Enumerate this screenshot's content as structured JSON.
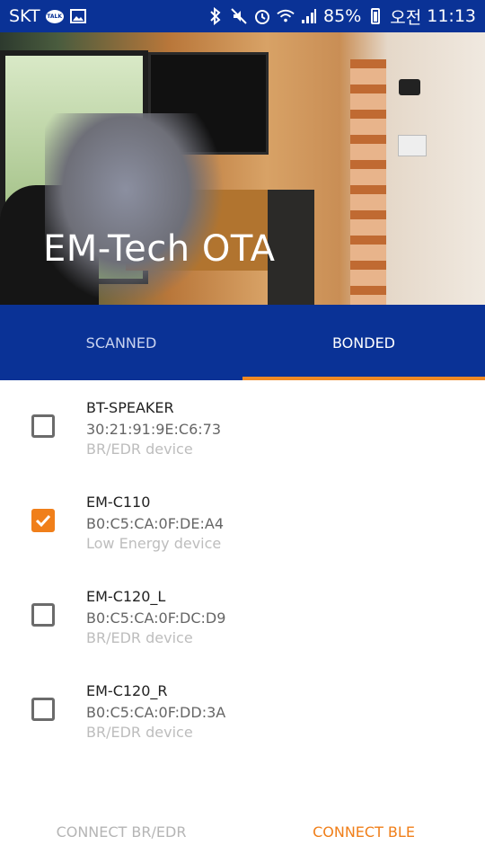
{
  "status_bar": {
    "carrier": "SKT",
    "battery": "85%",
    "ampm": "오전",
    "time": "11:13",
    "icons": [
      "talk-icon",
      "image-icon",
      "bluetooth-icon",
      "mute-icon",
      "alarm-icon",
      "wifi-icon",
      "signal-icon",
      "battery-icon"
    ]
  },
  "header": {
    "title": "EM-Tech OTA"
  },
  "tabs": [
    {
      "label": "SCANNED",
      "active": false
    },
    {
      "label": "BONDED",
      "active": true
    }
  ],
  "devices": [
    {
      "name": "BT-SPEAKER",
      "address": "30:21:91:9E:C6:73",
      "type": "BR/EDR device",
      "checked": false
    },
    {
      "name": "EM-C110",
      "address": "B0:C5:CA:0F:DE:A4",
      "type": "Low Energy device",
      "checked": true
    },
    {
      "name": "EM-C120_L",
      "address": "B0:C5:CA:0F:DC:D9",
      "type": "BR/EDR device",
      "checked": false
    },
    {
      "name": "EM-C120_R",
      "address": "B0:C5:CA:0F:DD:3A",
      "type": "BR/EDR device",
      "checked": false
    }
  ],
  "actions": {
    "connect_bredr": "CONNECT BR/EDR",
    "connect_ble": "CONNECT BLE"
  },
  "colors": {
    "primary": "#0a3296",
    "accent": "#f07f1a"
  }
}
